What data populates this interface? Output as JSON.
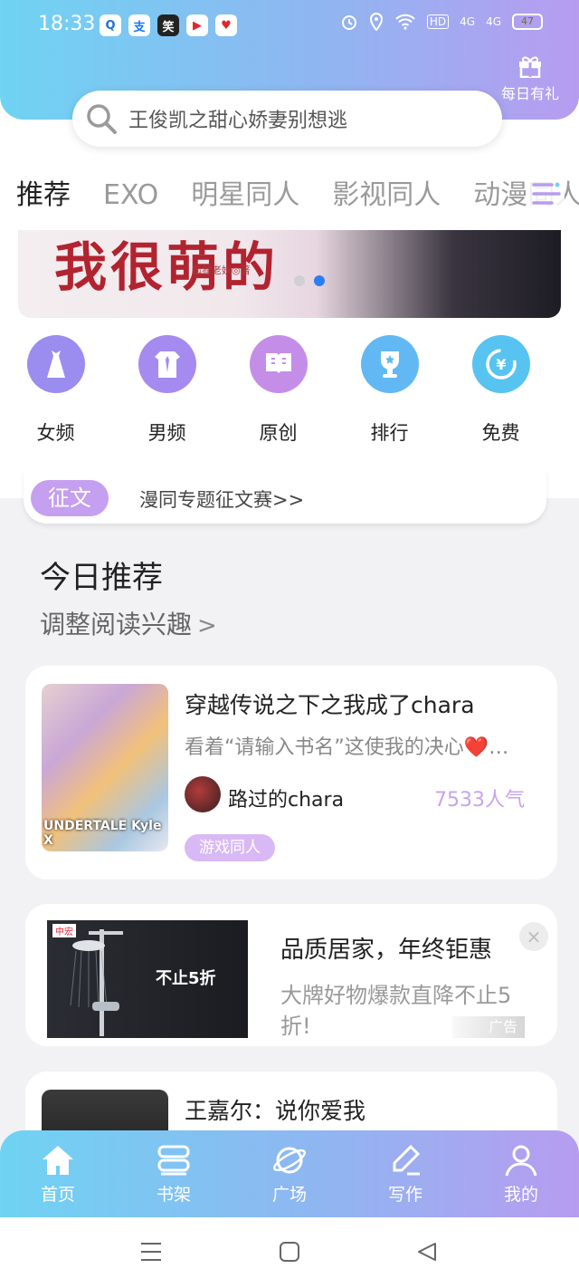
{
  "status_bar": {
    "time": "18:33",
    "apps": [
      "Q",
      "支",
      "笑",
      "▶",
      "♥"
    ],
    "hd_label": "HD",
    "net1": "4G",
    "net2": "4G",
    "battery": "47"
  },
  "header": {
    "gift_label": "每日有礼",
    "search_placeholder": "王俊凯之甜心娇妻别想逃"
  },
  "tabs": [
    {
      "label": "推荐",
      "active": true
    },
    {
      "label": "EXO"
    },
    {
      "label": "明星同人"
    },
    {
      "label": "影视同人"
    },
    {
      "label": "动漫同人"
    }
  ],
  "banner": {
    "title": "我很萌的",
    "author": "狐狸老妖◎著",
    "active_dot": 1
  },
  "categories": [
    {
      "label": "女频",
      "icon": "dress-icon",
      "color": "#9b8cf0"
    },
    {
      "label": "男频",
      "icon": "shirt-icon",
      "color": "#a58af0"
    },
    {
      "label": "原创",
      "icon": "book-icon",
      "color": "#c48ee8"
    },
    {
      "label": "排行",
      "icon": "trophy-icon",
      "color": "#62b8f2"
    },
    {
      "label": "免费",
      "icon": "coin-icon",
      "color": "#57c3f0"
    }
  ],
  "contest": {
    "tag": "征文",
    "text": "漫同专题征文赛>>"
  },
  "recommend": {
    "title": "今日推荐",
    "subtitle": "调整阅读兴趣",
    "subtitle_chevron": ">"
  },
  "books": [
    {
      "title": "穿越传说之下之我成了chara",
      "desc": "看着“请输入书名”这使我的决心❤️…",
      "author": "路过的chara",
      "popularity": "7533人气",
      "tag": "游戏同人",
      "cover_text": "UNDERTALE Kyle X"
    },
    {
      "title": "王嘉尔：说你爱我"
    }
  ],
  "ad": {
    "title": "品质居家，年终钜惠",
    "desc": "大牌好物爆款直降不止5折!",
    "badge": "广告",
    "close": "×",
    "image_sale": "不止5折",
    "image_brand": "中宏"
  },
  "bottom_nav": [
    {
      "label": "首页",
      "icon": "home-icon"
    },
    {
      "label": "书架",
      "icon": "bookshelf-icon"
    },
    {
      "label": "广场",
      "icon": "planet-icon"
    },
    {
      "label": "写作",
      "icon": "pen-icon"
    },
    {
      "label": "我的",
      "icon": "user-icon"
    }
  ]
}
